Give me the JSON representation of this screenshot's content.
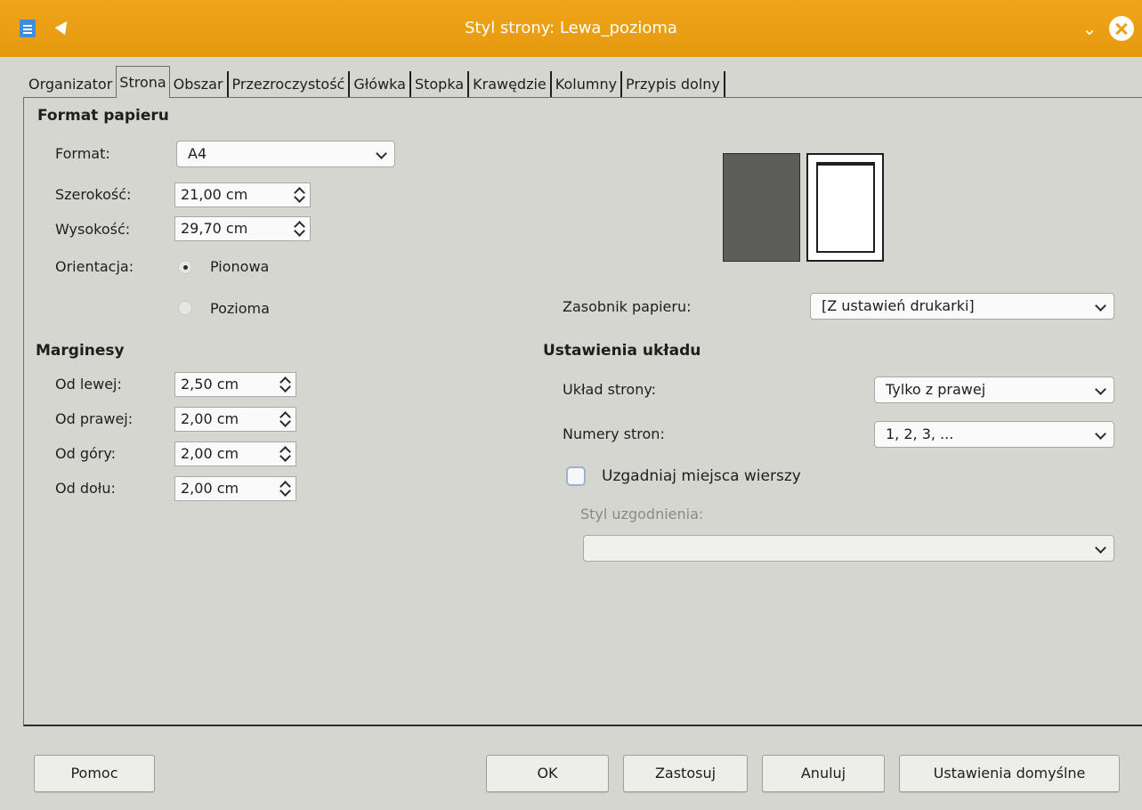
{
  "window": {
    "title": "Styl strony: Lewa_pozioma"
  },
  "tabs": [
    {
      "label": "Organizator"
    },
    {
      "label": "Strona"
    },
    {
      "label": "Obszar"
    },
    {
      "label": "Przezroczystość"
    },
    {
      "label": "Główka"
    },
    {
      "label": "Stopka"
    },
    {
      "label": "Krawędzie"
    },
    {
      "label": "Kolumny"
    },
    {
      "label": "Przypis dolny"
    }
  ],
  "paper_format": {
    "section_title": "Format papieru",
    "format_label": "Format:",
    "format_value": "A4",
    "width_label": "Szerokość:",
    "width_value": "21,00 cm",
    "height_label": "Wysokość:",
    "height_value": "29,70 cm",
    "orientation_label": "Orientacja:",
    "portrait_label": "Pionowa",
    "landscape_label": "Pozioma",
    "tray_label": "Zasobnik papieru:",
    "tray_value": "[Z ustawień drukarki]"
  },
  "margins": {
    "section_title": "Marginesy",
    "left_label": "Od lewej:",
    "left_value": "2,50 cm",
    "right_label": "Od prawej:",
    "right_value": "2,00 cm",
    "top_label": "Od góry:",
    "top_value": "2,00 cm",
    "bottom_label": "Od dołu:",
    "bottom_value": "2,00 cm"
  },
  "layout": {
    "section_title": "Ustawienia układu",
    "page_layout_label": "Układ strony:",
    "page_layout_value": "Tylko z prawej",
    "page_numbers_label": "Numery stron:",
    "page_numbers_value": "1, 2, 3, ...",
    "register_label": "Uzgadniaj miejsca wierszy",
    "reference_style_label": "Styl uzgodnienia:",
    "reference_style_value": ""
  },
  "buttons": {
    "help": "Pomoc",
    "ok": "OK",
    "apply": "Zastosuj",
    "cancel": "Anuluj",
    "defaults": "Ustawienia domyślne"
  },
  "colors": {
    "titlebar": "#e9a011",
    "background": "#d6d6d1"
  }
}
